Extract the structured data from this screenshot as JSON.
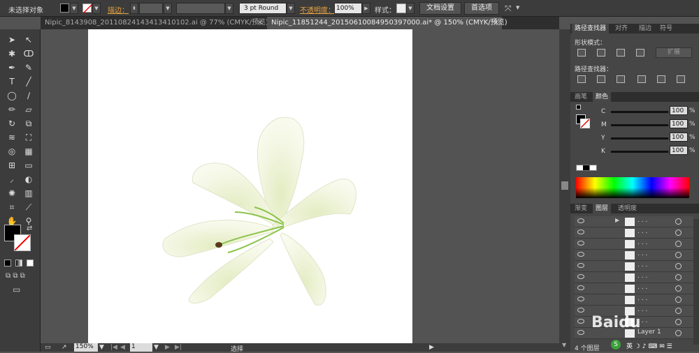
{
  "control_bar": {
    "selection": "未选择对象",
    "stroke_label": "描边：",
    "brush": "3 pt Round",
    "opacity_label": "不透明度：",
    "opacity_value": "100%",
    "style_label": "样式：",
    "doc_setup": "文档设置",
    "preferences": "首选项"
  },
  "tabs": [
    {
      "label": "Nipic_8143908_20110824143413410102.ai @ 77% (CMYK/预览)"
    },
    {
      "label": "Nipic_11851244_20150610084950397000.ai* @ 150% (CMYK/预览)"
    }
  ],
  "status": {
    "zoom": "150%",
    "page": "1",
    "tool": "选择"
  },
  "pathfinder": {
    "tabs": [
      "路径查找器",
      "对齐",
      "描边",
      "符号"
    ],
    "shape_modes": "形状模式：",
    "expand": "扩展",
    "pathfinders": "路径查找器："
  },
  "color": {
    "tabs": [
      "画笔",
      "颜色"
    ],
    "channels": [
      {
        "name": "C",
        "value": "100"
      },
      {
        "name": "M",
        "value": "100"
      },
      {
        "name": "Y",
        "value": "100"
      },
      {
        "name": "K",
        "value": "100"
      }
    ],
    "pct": "%"
  },
  "layers": {
    "tabs": [
      "渐变",
      "图层",
      "透明度"
    ],
    "rows": [
      {
        "name": ". . ."
      },
      {
        "name": ". . ."
      },
      {
        "name": ". . ."
      },
      {
        "name": ". . ."
      },
      {
        "name": ". . ."
      },
      {
        "name": ". . ."
      },
      {
        "name": ". . ."
      },
      {
        "name": ". . ."
      },
      {
        "name": ". . ."
      },
      {
        "name": ". . ."
      },
      {
        "name": "Layer 1"
      }
    ],
    "count": "4 个图层",
    "watermark": "Baidu"
  },
  "colors": {
    "accent": "#3c3c3c",
    "petal": "#f6f8e6",
    "stem": "#8bc34a"
  }
}
